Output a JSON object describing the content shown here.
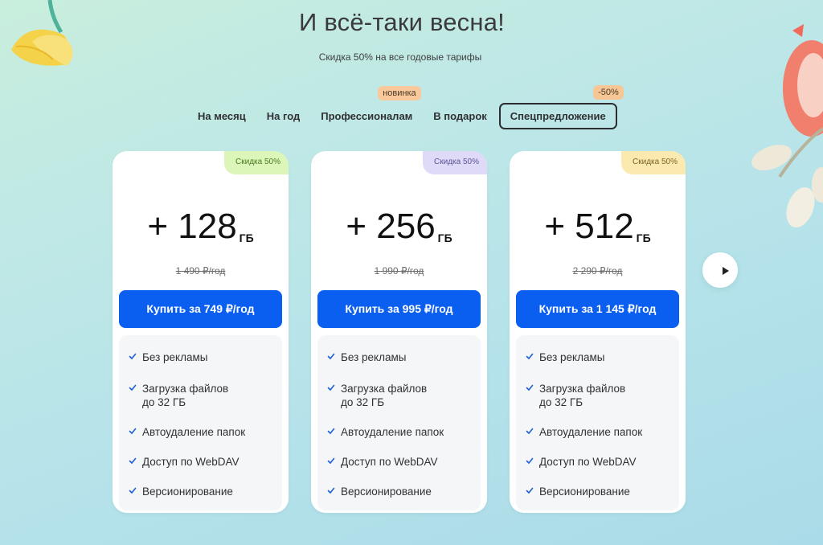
{
  "hero": {
    "title": "И всё-таки весна!",
    "subtitle": "Скидка 50% на все годовые тарифы"
  },
  "tabs": [
    {
      "label": "На месяц",
      "active": false
    },
    {
      "label": "На год",
      "active": false
    },
    {
      "label": "Профессионалам",
      "active": false,
      "tag": "новинка"
    },
    {
      "label": "В подарок",
      "active": false
    },
    {
      "label": "Спецпредложение",
      "active": true,
      "tag": "-50%"
    }
  ],
  "plans": [
    {
      "badge": "Скидка 50%",
      "badge_color": "#dcf5b8",
      "volume": "+ 128",
      "unit": "ГБ",
      "old_price": "1 490 ₽/год",
      "button": "Купить за 749 ₽/год"
    },
    {
      "badge": "Скидка 50%",
      "badge_color": "#dedaf8",
      "volume": "+ 256",
      "unit": "ГБ",
      "old_price": "1 990 ₽/год",
      "button": "Купить за 995 ₽/год"
    },
    {
      "badge": "Скидка 50%",
      "badge_color": "#fbeab0",
      "volume": "+ 512",
      "unit": "ГБ",
      "old_price": "2 290 ₽/год",
      "button": "Купить за 1 145 ₽/год"
    }
  ],
  "features": [
    "Без рекламы",
    "Загрузка файлов\nдо 32 ГБ",
    "Автоудаление папок",
    "Доступ по WebDAV",
    "Версионирование"
  ],
  "colors": {
    "accent": "#0a5ef0",
    "check": "#1f5fd8"
  },
  "next_icon": "play-arrow-icon"
}
